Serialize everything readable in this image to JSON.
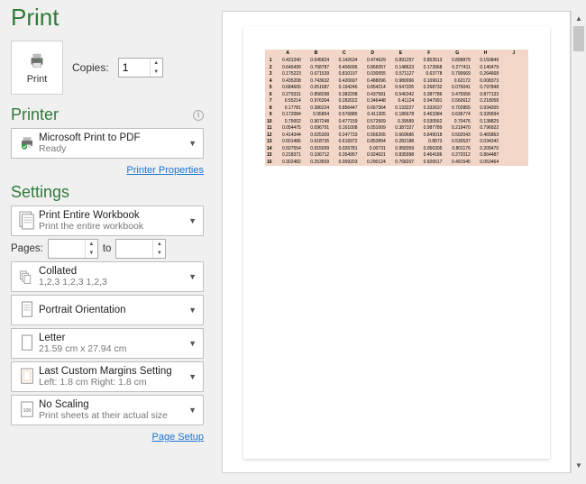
{
  "header": {
    "title": "Print"
  },
  "print_button": {
    "label": "Print"
  },
  "copies": {
    "label": "Copies:",
    "value": "1"
  },
  "printer_section": {
    "title": "Printer"
  },
  "printer": {
    "name": "Microsoft Print to PDF",
    "status": "Ready",
    "properties_link": "Printer Properties"
  },
  "settings_section": {
    "title": "Settings"
  },
  "settings": {
    "scope": {
      "primary": "Print Entire Workbook",
      "secondary": "Print the entire workbook"
    },
    "pages": {
      "label": "Pages:",
      "to": "to"
    },
    "collate": {
      "primary": "Collated",
      "secondary": "1,2,3   1,2,3   1,2,3"
    },
    "orientation": {
      "primary": "Portrait Orientation"
    },
    "paper": {
      "primary": "Letter",
      "secondary": "21.59 cm x 27.94 cm"
    },
    "margins": {
      "primary": "Last Custom Margins Setting",
      "secondary": "Left:  1.8 cm    Right:  1.8 cm"
    },
    "scaling": {
      "primary": "No Scaling",
      "secondary": "Print sheets at their actual size"
    }
  },
  "page_setup_link": "Page Setup",
  "preview": {
    "columns": [
      "A",
      "B",
      "C",
      "D",
      "E",
      "F",
      "G",
      "H",
      "J"
    ],
    "rows": [
      [
        "0.431340",
        "0.645824",
        "0.142634",
        "0.474629",
        "0.891257",
        "0.853513",
        "0.898879",
        "0.150849"
      ],
      [
        "0.646499",
        "0.768787",
        "0.406696",
        "0.866057",
        "0.148623",
        "0.173968",
        "0.277411",
        "0.140479"
      ],
      [
        "0.175223",
        "0.671539",
        "0.810197",
        "0.030055",
        "0.571127",
        "0.63778",
        "0.790669",
        "0.264668"
      ],
      [
        "0.435208",
        "0.743632",
        "0.420697",
        "0.488096",
        "0.980096",
        "0.109613",
        "0.62172",
        "0.008373"
      ],
      [
        "0.684665",
        "0.051687",
        "0.194246",
        "0.854214",
        "0.647205",
        "0.268732",
        "0.079041",
        "0.797848"
      ],
      [
        "0.279331",
        "0.858298",
        "0.382298",
        "0.437581",
        "0.546342",
        "0.387786",
        "0.475556",
        "0.877133"
      ],
      [
        "0.55214",
        "0.976304",
        "0.282022",
        "0.346448",
        "0.41124",
        "0.947991",
        "0.560612",
        "0.218058"
      ],
      [
        "0.17781",
        "0.386224",
        "0.856447",
        "0.667364",
        "0.133227",
        "0.332637",
        "0.702855",
        "0.934205"
      ],
      [
        "0.172084",
        "0.95854",
        "0.576885",
        "0.411305",
        "0.186678",
        "0.463384",
        "0.636774",
        "0.326694"
      ],
      [
        "0.75002",
        "0.907248",
        "0.477159",
        "0.572669",
        "0.39589",
        "0.530562",
        "0.70476",
        "0.138829"
      ],
      [
        "0.054475",
        "0.096791",
        "0.161008",
        "0.051009",
        "0.387327",
        "0.987789",
        "0.219470",
        "0.796922"
      ],
      [
        "0.414344",
        "0.025309",
        "0.247733",
        "0.566265",
        "0.669686",
        "0.849018",
        "0.502043",
        "0.465863"
      ],
      [
        "0.501486",
        "0.618735",
        "0.616972",
        "0.853894",
        "0.282188",
        "0.8673",
        "0.530537",
        "0.034342"
      ],
      [
        "0.507554",
        "0.915099",
        "0.026781",
        "0.00731",
        "0.958359",
        "0.056305",
        "0.801176",
        "0.209470"
      ],
      [
        "0.218371",
        "0.106712",
        "0.354957",
        "0.924021",
        "0.835998",
        "0.464186",
        "0.272012",
        "0.864487"
      ],
      [
        "0.302482",
        "0.253509",
        "0.009203",
        "0.290124",
        "0.768207",
        "0.926517",
        "0.491545",
        "0.053464"
      ]
    ]
  }
}
